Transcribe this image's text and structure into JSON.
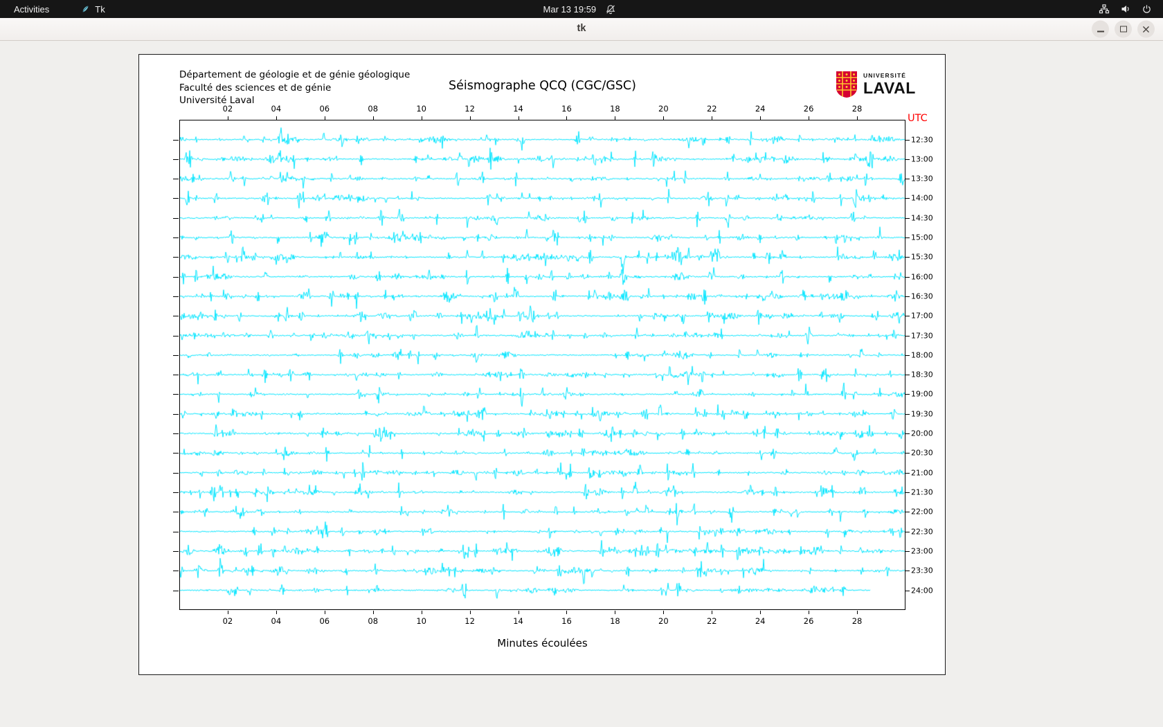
{
  "topbar": {
    "activities": "Activities",
    "app_name": "Tk",
    "clock": "Mar 13 19:59",
    "icons": [
      "tk-feather-icon",
      "notifications-muted-icon",
      "network-icon",
      "volume-icon",
      "power-icon"
    ]
  },
  "window": {
    "title": "tk",
    "controls": [
      "minimize",
      "restore",
      "close"
    ]
  },
  "seismograph": {
    "header_lines": [
      "Département de géologie et de génie géologique",
      "Faculté des sciences et de génie",
      "Université Laval"
    ],
    "title": "Séismographe QCQ (CGC/GSC)",
    "utc_label": "UTC",
    "utc_color": "#ff0000",
    "xlabel": "Minutes écoulées",
    "minutes_span": 30,
    "minute_ticks": [
      "02",
      "04",
      "06",
      "08",
      "10",
      "12",
      "14",
      "16",
      "18",
      "20",
      "22",
      "24",
      "26",
      "28"
    ],
    "trace_times": [
      "12:30",
      "13:00",
      "13:30",
      "14:00",
      "14:30",
      "15:00",
      "15:30",
      "16:00",
      "16:30",
      "17:00",
      "17:30",
      "18:00",
      "18:30",
      "19:00",
      "19:30",
      "20:00",
      "20:30",
      "21:00",
      "21:30",
      "22:00",
      "22:30",
      "23:00",
      "23:30",
      "24:00"
    ],
    "trace_color": "#00e5ff",
    "last_trace_end_fraction": 0.953,
    "logo": {
      "small_text": "UNIVERSITÉ",
      "large_text": "LAVAL",
      "shield_red": "#d50032",
      "shield_gold": "#ffc72c"
    }
  }
}
